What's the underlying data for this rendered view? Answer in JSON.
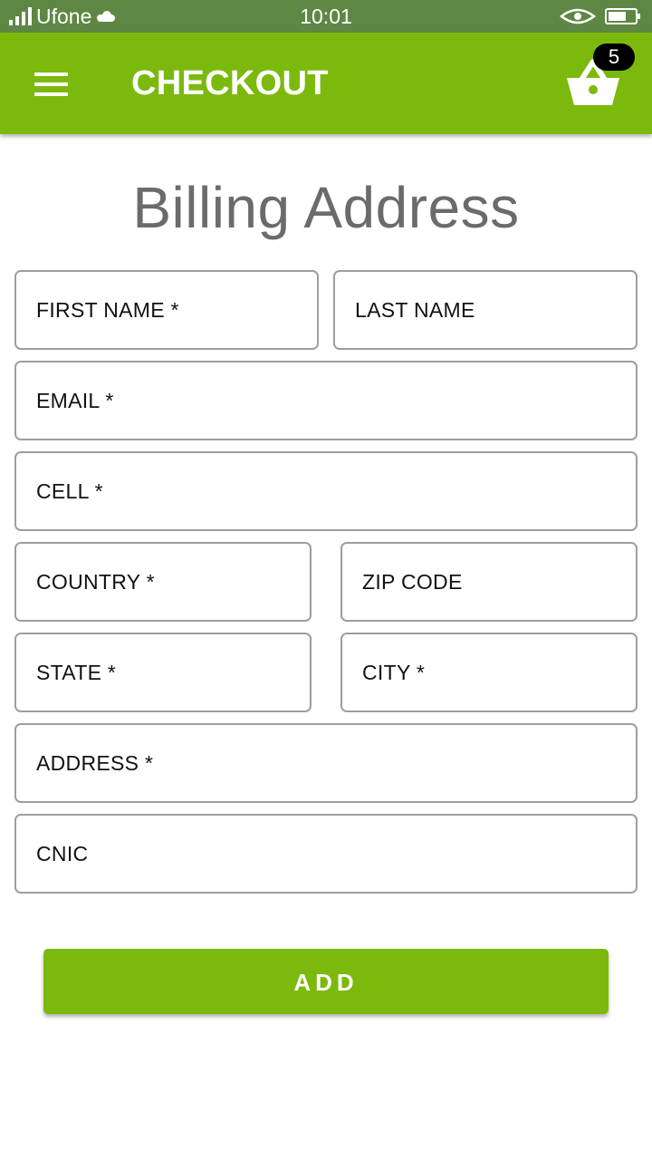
{
  "status_bar": {
    "carrier": "Ufone",
    "time": "10:01"
  },
  "app_bar": {
    "title": "CHECKOUT",
    "cart_count": "5"
  },
  "form": {
    "title": "Billing Address",
    "fields": {
      "first_name": "FIRST NAME *",
      "last_name": "LAST NAME",
      "email": "EMAIL *",
      "cell": "CELL *",
      "country": "COUNTRY *",
      "zip_code": "ZIP CODE",
      "state": "STATE *",
      "city": "CITY *",
      "address": "ADDRESS *",
      "cnic": "CNIC"
    },
    "submit_label": "ADD"
  },
  "colors": {
    "status_bar": "#5f8744",
    "brand_green": "#7cb90d",
    "title_gray": "#6b6b6b",
    "field_border": "#9e9e9e"
  }
}
